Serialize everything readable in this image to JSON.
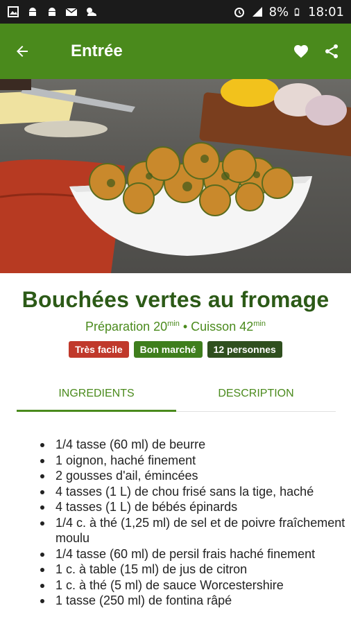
{
  "status_bar": {
    "battery": "8%",
    "time": "18:01",
    "icons": [
      "image-icon",
      "android-icon",
      "android-icon",
      "mail-icon",
      "weather-icon",
      "alarm-icon",
      "signal-icon",
      "battery-icon"
    ]
  },
  "app_bar": {
    "title": "Entrée",
    "icons": [
      "back-arrow-icon",
      "heart-icon",
      "share-icon"
    ],
    "color": "#4a8a1c"
  },
  "recipe": {
    "title": "Bouchées vertes au fromage",
    "prep_label": "Préparation 20",
    "prep_unit": "min",
    "separator": " • ",
    "cook_label": "Cuisson 42",
    "cook_unit": "min",
    "badges": [
      {
        "label": "Très facile",
        "color": "#c0392b"
      },
      {
        "label": "Bon marché",
        "color": "#3f7e1d"
      },
      {
        "label": "12 personnes",
        "color": "#2f4f1e"
      }
    ]
  },
  "tabs": [
    {
      "label": "INGREDIENTS",
      "active": true
    },
    {
      "label": "DESCRIPTION",
      "active": false
    }
  ],
  "ingredients": [
    "1/4 tasse (60 ml) de beurre",
    "1 oignon, haché finement",
    "2 gousses d'ail, émincées",
    "4 tasses (1 L) de chou frisé sans la tige, haché",
    "4 tasses (1 L) de bébés épinards",
    "1/4 c. à thé (1,25 ml) de sel et de poivre fraîchement moulu",
    "1/4 tasse (60 ml) de persil frais haché finement",
    "1 c. à table (15 ml) de jus de citron",
    "1 c. à thé (5 ml) de sauce Worcestershire",
    "1 tasse (250 ml) de fontina râpé"
  ]
}
